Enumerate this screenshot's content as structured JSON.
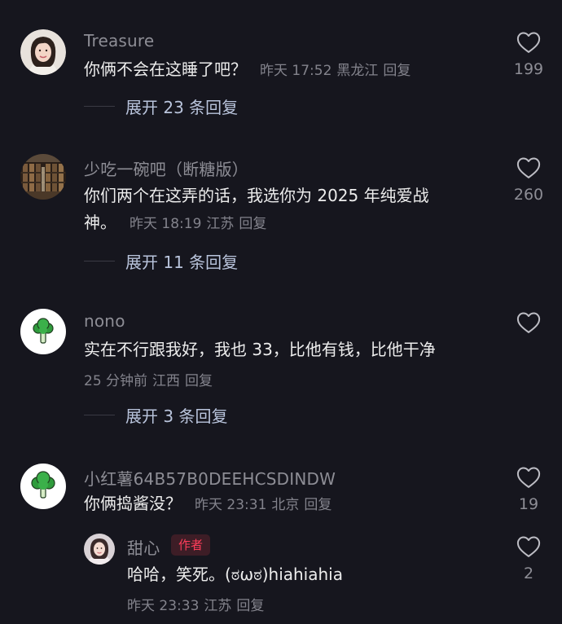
{
  "comments": [
    {
      "username": "Treasure",
      "text_lines": [
        "你俩不会在这睡了吧？"
      ],
      "time": "昨天 17:52",
      "location": "黑龙江",
      "reply_label": "回复",
      "likes": "199",
      "expand_label": "展开 23 条回复"
    },
    {
      "username": "少吃一碗吧（断糖版）",
      "text_lines": [
        "你们两个在这弄的话，我选你为 2025 年纯爱战",
        "神。"
      ],
      "time": "昨天 18:19",
      "location": "江苏",
      "reply_label": "回复",
      "likes": "260",
      "expand_label": "展开 11 条回复"
    },
    {
      "username": "nono",
      "text_lines": [
        "实在不行跟我好，我也 33，比他有钱，比他干净"
      ],
      "time": "25 分钟前",
      "location": "江西",
      "reply_label": "回复",
      "likes": "",
      "expand_label": "展开 3 条回复"
    },
    {
      "username": "小红薯64B57B0DEEHCSDINDW",
      "text_lines": [
        "你俩捣酱没？"
      ],
      "time": "昨天 23:31",
      "location": "北京",
      "reply_label": "回复",
      "likes": "19",
      "reply": {
        "username": "甜心",
        "badge": "作者",
        "text_lines": [
          "哈哈，笑死。(ಠωಠ)hiahiahia"
        ],
        "time": "昨天 23:33",
        "location": "江苏",
        "reply_label": "回复",
        "likes": "2"
      }
    }
  ],
  "icons": {
    "like": "heart-outline-icon",
    "avatar_broccoli": "broccoli-icon"
  },
  "colors": {
    "background": "#16161e",
    "link": "#b9c4dc",
    "author_badge": "#ff3d5a"
  }
}
